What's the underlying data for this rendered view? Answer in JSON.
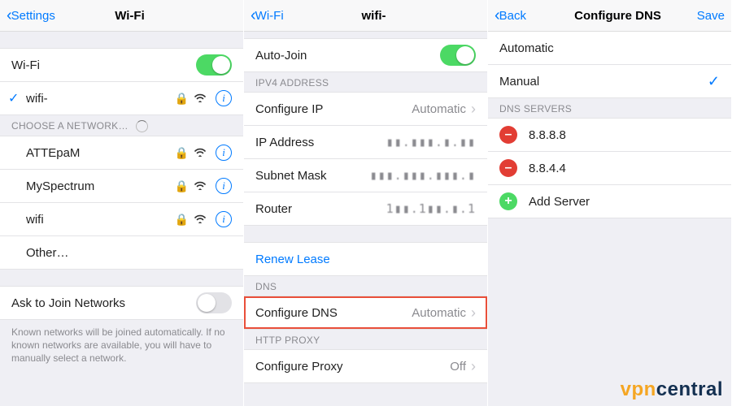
{
  "panel1": {
    "nav_back": "Settings",
    "title": "Wi-Fi",
    "wifi_label": "Wi-Fi",
    "wifi_on": true,
    "connected_network": "wifi-",
    "section_choose": "CHOOSE A NETWORK…",
    "networks": [
      {
        "name": "ATTEpaM",
        "locked": true
      },
      {
        "name": "MySpectrum",
        "locked": true
      },
      {
        "name": "wifi",
        "locked": true
      },
      {
        "name": "Other…",
        "locked": false
      }
    ],
    "ask_label": "Ask to Join Networks",
    "ask_on": false,
    "footnote": "Known networks will be joined automatically. If no known networks are available, you will have to manually select a network."
  },
  "panel2": {
    "nav_back": "Wi-Fi",
    "title": "wifi-",
    "autojoin_label": "Auto-Join",
    "autojoin_on": true,
    "section_ipv4": "IPV4 ADDRESS",
    "config_ip_label": "Configure IP",
    "config_ip_value": "Automatic",
    "ip_label": "IP Address",
    "ip_value": "▮▮.▮▮▮.▮.▮▮",
    "mask_label": "Subnet Mask",
    "mask_value": "▮▮▮.▮▮▮.▮▮▮.▮",
    "router_label": "Router",
    "router_value": "1▮▮.1▮▮.▮.1",
    "renew_label": "Renew Lease",
    "section_dns": "DNS",
    "config_dns_label": "Configure DNS",
    "config_dns_value": "Automatic",
    "section_proxy": "HTTP PROXY",
    "config_proxy_label": "Configure Proxy",
    "config_proxy_value": "Off"
  },
  "panel3": {
    "nav_back": "Back",
    "title": "Configure DNS",
    "nav_save": "Save",
    "option_auto": "Automatic",
    "option_manual": "Manual",
    "selected": "Manual",
    "section_servers": "DNS SERVERS",
    "servers": [
      "8.8.8.8",
      "8.8.4.4"
    ],
    "add_label": "Add Server"
  },
  "watermark": {
    "vpn": "vpn",
    "rest": "central"
  }
}
